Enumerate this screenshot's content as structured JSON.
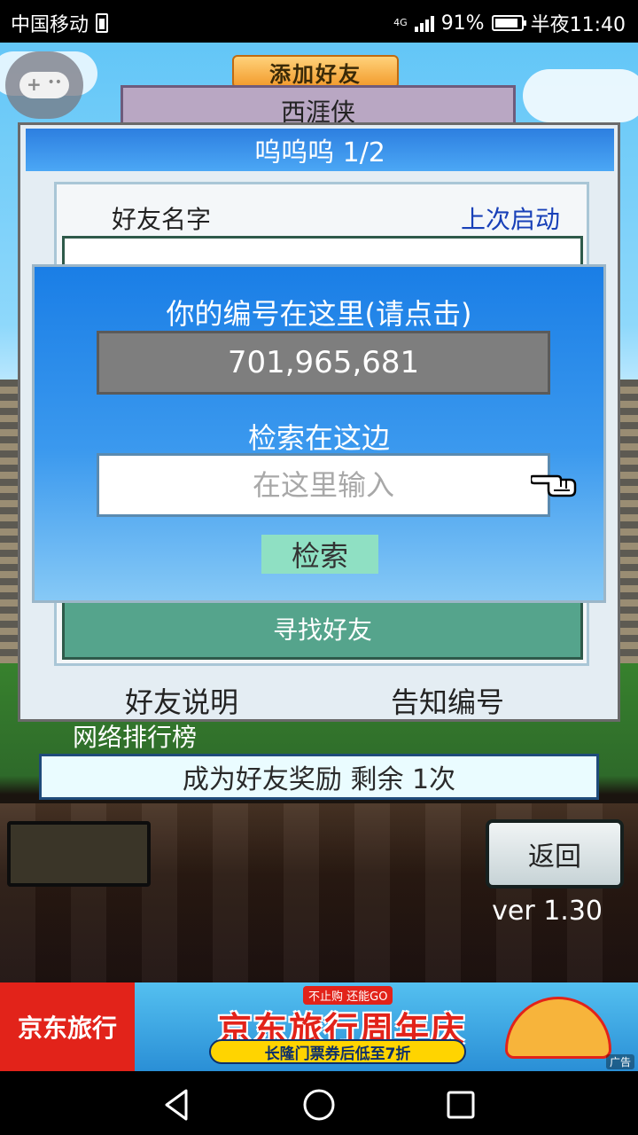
{
  "status_bar": {
    "carrier": "中国移动",
    "network": "4G",
    "battery_percent": "91%",
    "time": "半夜11:40"
  },
  "background": {
    "add_friend_tab": "添加好友",
    "behind_panel_text": "西涯侠",
    "ranking_label": "网络排行榜"
  },
  "dialog": {
    "title": "呜呜呜 1/2",
    "col_name": "好友名字",
    "col_last_start": "上次启动",
    "find_friend_button": "寻找好友",
    "friend_help_link": "好友说明",
    "share_id_link": "告知编号"
  },
  "popup": {
    "id_label": "你的编号在这里(请点击)",
    "id_value": "701,965,681",
    "search_label": "检索在这边",
    "search_placeholder": "在这里输入",
    "search_button": "检索"
  },
  "bonus_bar": "成为好友奖励 剩余 1次",
  "back_button": "返回",
  "version": "ver 1.30",
  "ad": {
    "brand": "京东旅行",
    "tag": "不止购 还能GO",
    "headline": "京东旅行周年庆",
    "subline": "长隆门票券后低至7折",
    "badge": "广告"
  },
  "icons": {
    "gamepad": "gamepad-icon",
    "pointer": "pointing-hand-icon",
    "nav_back": "triangle-back-icon",
    "nav_home": "circle-home-icon",
    "nav_recent": "square-recent-icon"
  },
  "colors": {
    "dialog_title": "#2d7fe0",
    "popup_bg": "#1a7ee6",
    "find_friend": "#55a48c",
    "search_button": "#8fe0c3",
    "link_blue": "#1840b8"
  }
}
